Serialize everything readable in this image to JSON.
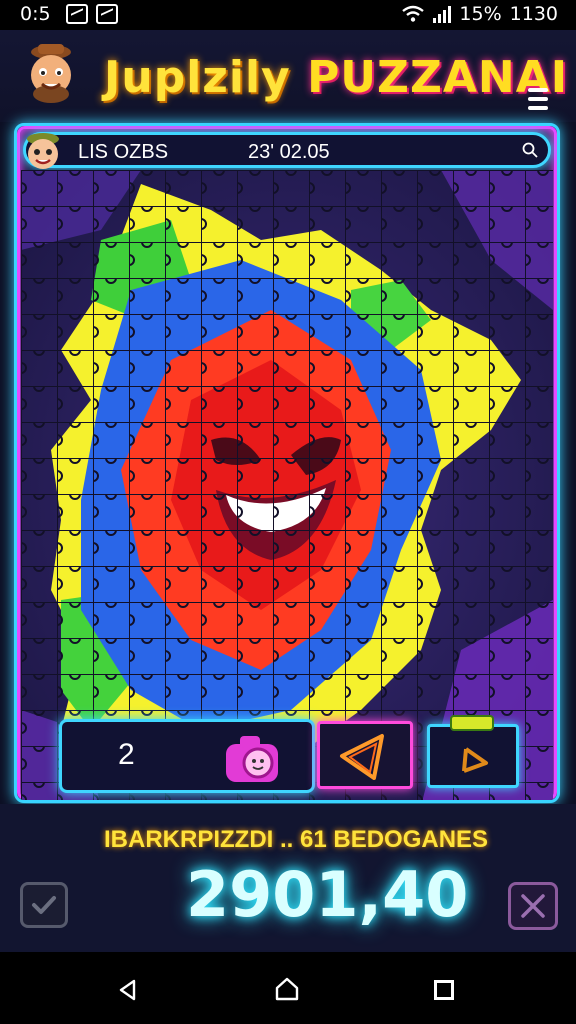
{
  "status_bar": {
    "time": "0:5",
    "battery": "15%",
    "clock": "1130"
  },
  "header": {
    "title_part1": "Juplzily",
    "title_part2": "PUZZANAI",
    "menu_icon": "hamburger-menu-icon"
  },
  "board": {
    "info_label": "LIS OZBS",
    "info_time": "23' 02.05",
    "search_icon": "search-icon",
    "piece_count": "2"
  },
  "footer": {
    "label": "IBARKRPIZZDI .. 61 BEDOGANES",
    "score": "2901,40"
  },
  "colors": {
    "accent_cyan": "#39d4ff",
    "accent_magenta": "#e44bff",
    "accent_yellow": "#ffe33b"
  }
}
